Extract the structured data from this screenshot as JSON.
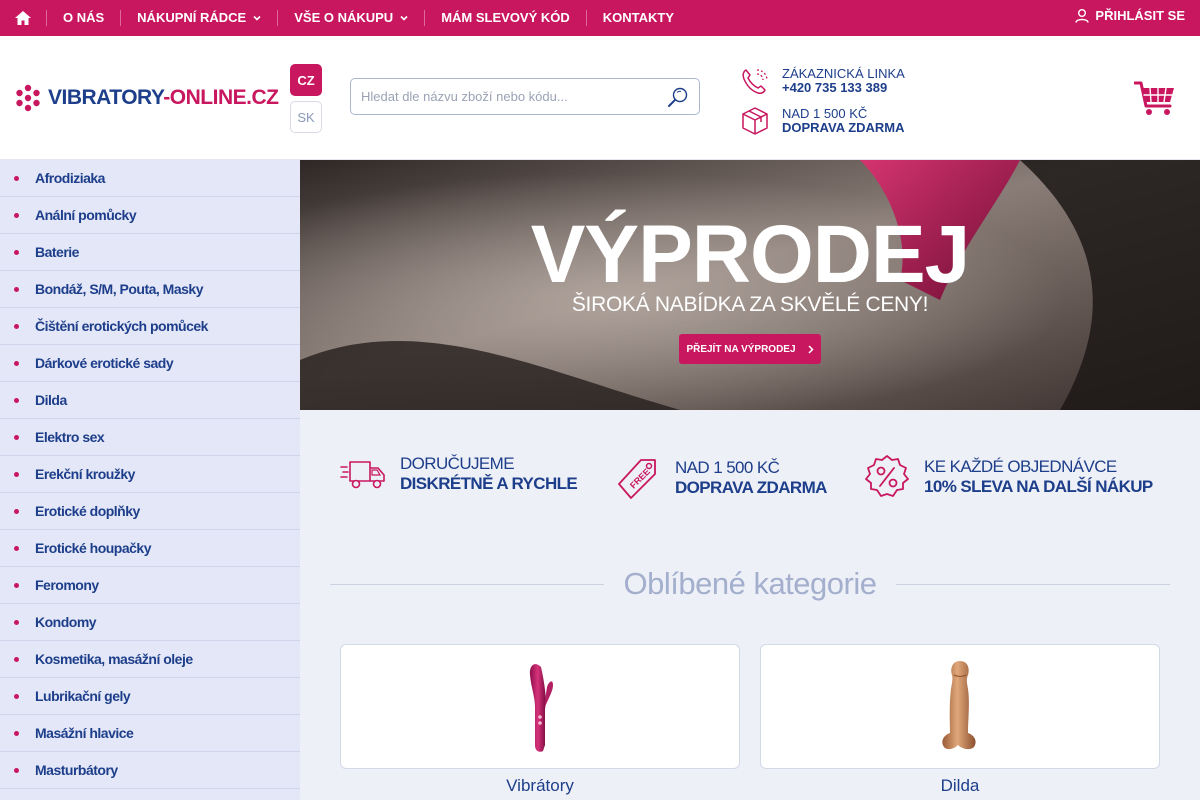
{
  "colors": {
    "brand": "#c8175f",
    "navy": "#1d3e8a",
    "sidebar_bg": "#e4e7f7",
    "content_bg": "#eef0f8"
  },
  "topnav": {
    "home_icon": "home-icon",
    "items": [
      {
        "label": "O NÁS",
        "dropdown": false
      },
      {
        "label": "NÁKUPNÍ RÁDCE",
        "dropdown": true
      },
      {
        "label": "VŠE O NÁKUPU",
        "dropdown": true
      },
      {
        "label": "MÁM SLEVOVÝ KÓD",
        "dropdown": false
      },
      {
        "label": "KONTAKTY",
        "dropdown": false
      }
    ],
    "login_label": "PŘIHLÁSIT SE"
  },
  "header": {
    "logo_main": "VIBRATORY",
    "logo_accent": "-ONLINE.CZ",
    "lang_cz": "CZ",
    "lang_sk": "SK",
    "search_placeholder": "Hledat dle názvu zboží nebo kódu...",
    "phone_title": "ZÁKAZNICKÁ LINKA",
    "phone_number": "+420 735 133 389",
    "shipping_title": "NAD 1 500 KČ",
    "shipping_value": "DOPRAVA ZDARMA"
  },
  "sidebar": {
    "categories": [
      "Afrodiziaka",
      "Anální pomůcky",
      "Baterie",
      "Bondáž, S/M, Pouta, Masky",
      "Čištění erotických pomůcek",
      "Dárkové erotické sady",
      "Dilda",
      "Elektro sex",
      "Erekční kroužky",
      "Erotické doplňky",
      "Erotické houpačky",
      "Feromony",
      "Kondomy",
      "Kosmetika, masážní oleje",
      "Lubrikační gely",
      "Masážní hlavice",
      "Masturbátory"
    ]
  },
  "hero": {
    "title": "VÝPRODEJ",
    "subtitle": "ŠIROKÁ NABÍDKA ZA SKVĚLÉ CENY!",
    "button_label": "PŘEJÍT NA VÝPRODEJ"
  },
  "benefits": [
    {
      "line1": "DORUČUJEME",
      "line2": "DISKRÉTNĚ A RYCHLE",
      "icon": "truck-icon"
    },
    {
      "line1": "NAD 1 500 KČ",
      "line2": "DOPRAVA ZDARMA",
      "icon": "free-tag-icon"
    },
    {
      "line1": "KE KAŽDÉ OBJEDNÁVCE",
      "line2": "10% SLEVA NA DALŠÍ NÁKUP",
      "icon": "percent-badge-icon"
    }
  ],
  "favorites": {
    "title": "Oblíbené kategorie",
    "cards": [
      {
        "label": "Vibrátory"
      },
      {
        "label": "Dilda"
      }
    ]
  }
}
